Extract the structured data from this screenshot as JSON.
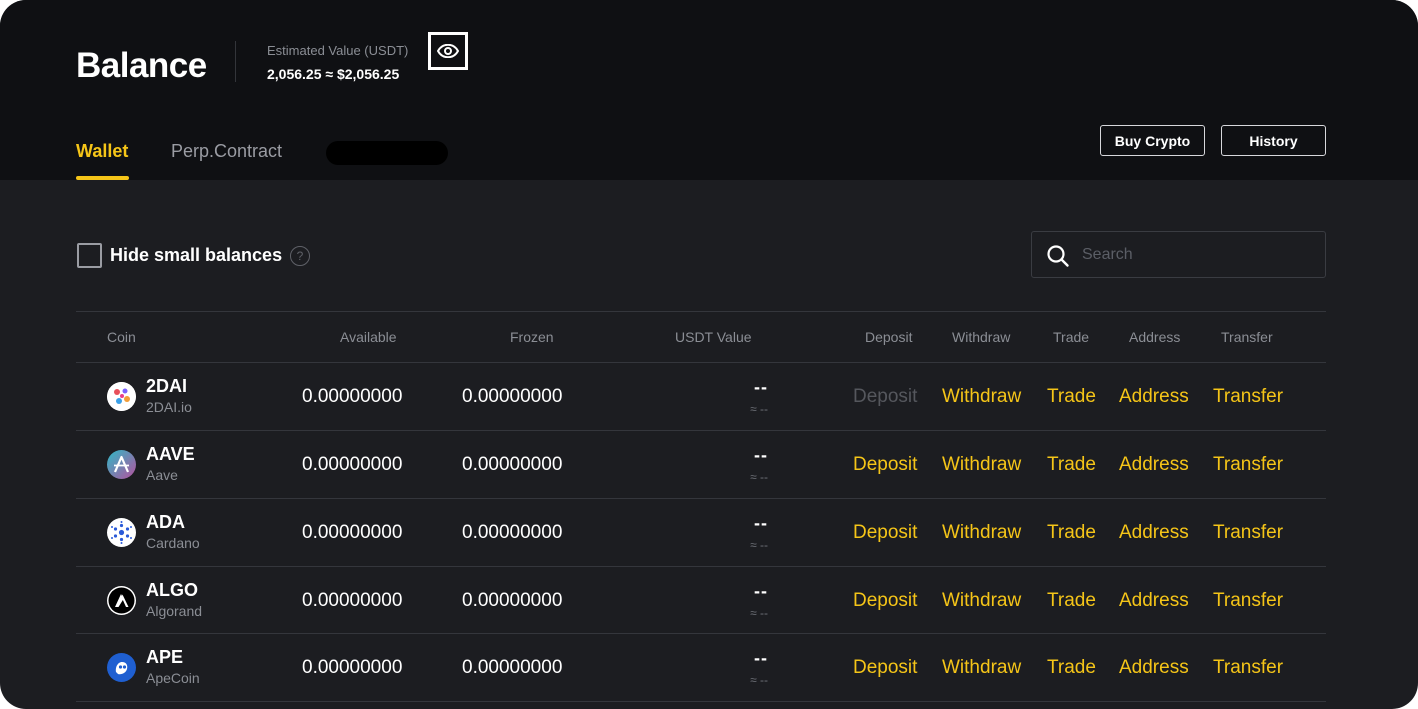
{
  "header": {
    "title": "Balance",
    "estimated_label": "Estimated Value (USDT)",
    "estimated_value": "2,056.25 ≈ $2,056.25",
    "eye_icon": "eye-icon",
    "tabs": [
      {
        "label": "Wallet",
        "active": true
      },
      {
        "label": "Perp.Contract",
        "active": false
      }
    ],
    "buy_crypto_label": "Buy Crypto",
    "history_label": "History"
  },
  "filters": {
    "hide_small_label": "Hide small balances",
    "help_symbol": "?",
    "search_placeholder": "Search"
  },
  "table": {
    "columns": [
      "Coin",
      "Available",
      "Frozen",
      "USDT Value",
      "Deposit",
      "Withdraw",
      "Trade",
      "Address",
      "Transfer"
    ],
    "rows": [
      {
        "symbol": "2DAI",
        "name": "2DAI.io",
        "available": "0.00000000",
        "frozen": "0.00000000",
        "usdt": "--",
        "usdt_sub": "≈ --",
        "deposit": "Deposit",
        "deposit_enabled": false,
        "withdraw": "Withdraw",
        "trade": "Trade",
        "address": "Address",
        "transfer": "Transfer",
        "logo_color": "#ffffff"
      },
      {
        "symbol": "AAVE",
        "name": "Aave",
        "available": "0.00000000",
        "frozen": "0.00000000",
        "usdt": "--",
        "usdt_sub": "≈ --",
        "deposit": "Deposit",
        "deposit_enabled": true,
        "withdraw": "Withdraw",
        "trade": "Trade",
        "address": "Address",
        "transfer": "Transfer",
        "logo_color": "#4a9fb7"
      },
      {
        "symbol": "ADA",
        "name": "Cardano",
        "available": "0.00000000",
        "frozen": "0.00000000",
        "usdt": "--",
        "usdt_sub": "≈ --",
        "deposit": "Deposit",
        "deposit_enabled": true,
        "withdraw": "Withdraw",
        "trade": "Trade",
        "address": "Address",
        "transfer": "Transfer",
        "logo_color": "#ffffff"
      },
      {
        "symbol": "ALGO",
        "name": "Algorand",
        "available": "0.00000000",
        "frozen": "0.00000000",
        "usdt": "--",
        "usdt_sub": "≈ --",
        "deposit": "Deposit",
        "deposit_enabled": true,
        "withdraw": "Withdraw",
        "trade": "Trade",
        "address": "Address",
        "transfer": "Transfer",
        "logo_color": "#ffffff"
      },
      {
        "symbol": "APE",
        "name": "ApeCoin",
        "available": "0.00000000",
        "frozen": "0.00000000",
        "usdt": "--",
        "usdt_sub": "≈ --",
        "deposit": "Deposit",
        "deposit_enabled": true,
        "withdraw": "Withdraw",
        "trade": "Trade",
        "address": "Address",
        "transfer": "Transfer",
        "logo_color": "#1f5fd1"
      }
    ]
  },
  "colors": {
    "accent": "#f5c518",
    "header_bg": "#0f1013",
    "body_bg": "#1c1d21"
  }
}
